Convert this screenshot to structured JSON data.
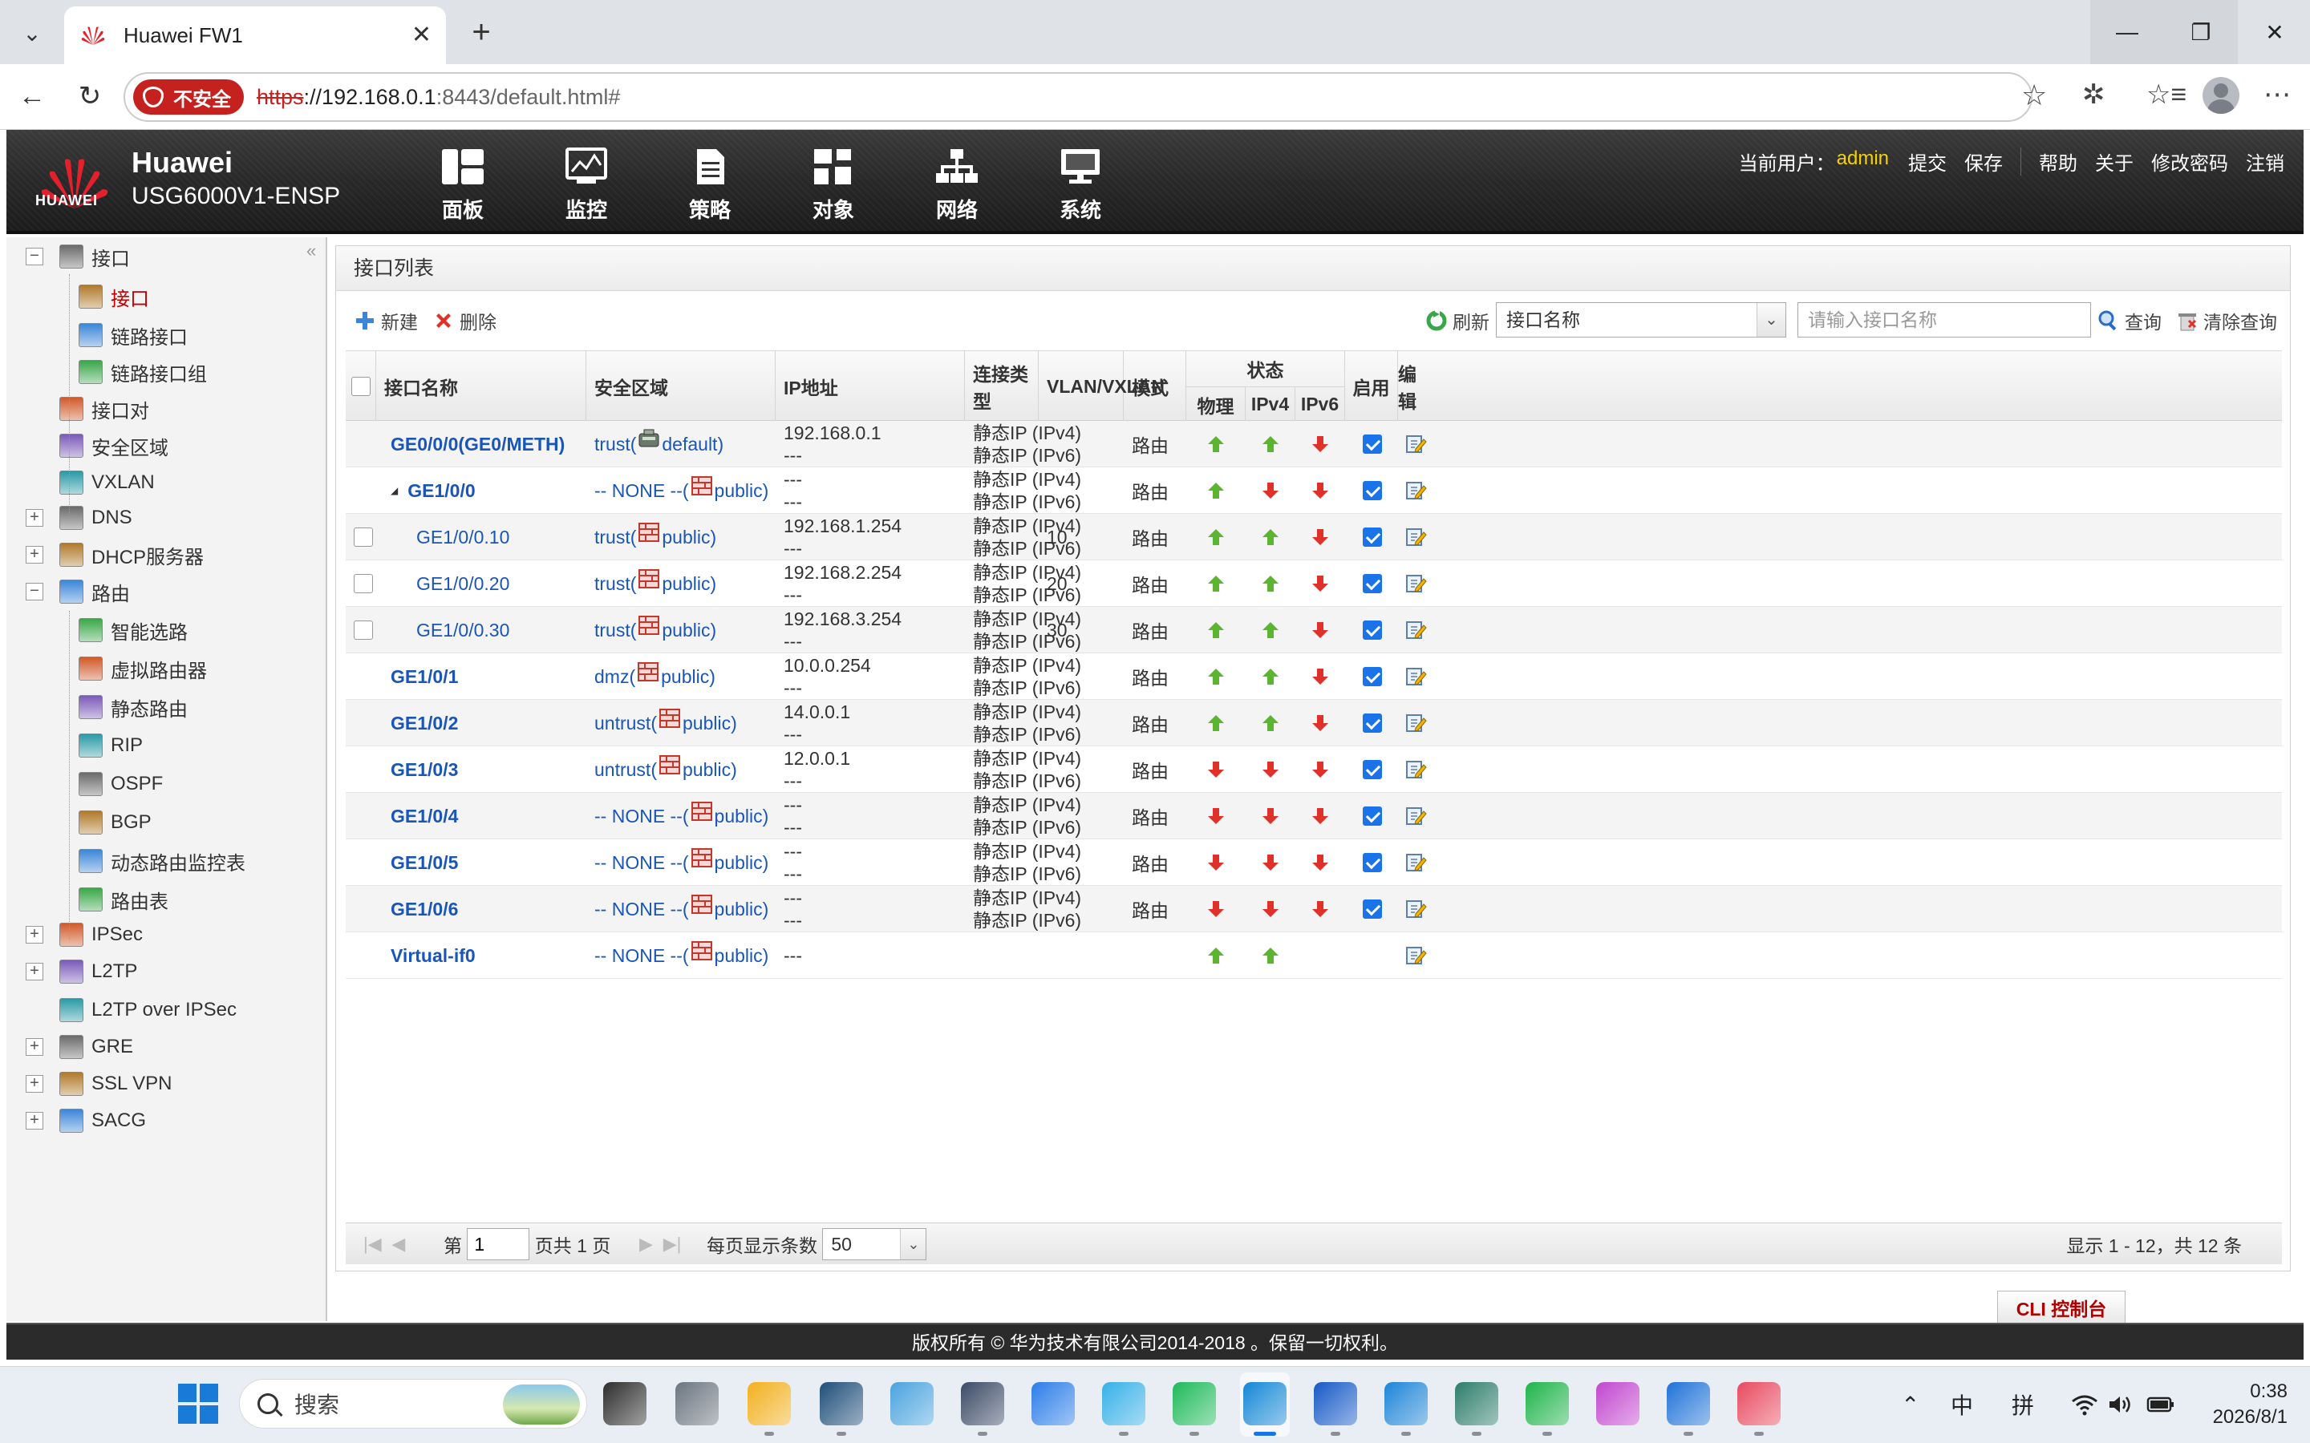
{
  "browser": {
    "tab_title": "Huawei FW1",
    "insecure_label": "不安全",
    "url_scheme": "https",
    "url_host": "://192.168.0.1",
    "url_port_path": ":8443/default.html#"
  },
  "header": {
    "brand_name": "Huawei",
    "model": "USG6000V1-ENSP",
    "logo_text": "HUAWEI",
    "nav": [
      {
        "label": "面板",
        "icon": "dashboard-icon"
      },
      {
        "label": "监控",
        "icon": "monitor-icon"
      },
      {
        "label": "策略",
        "icon": "policy-icon"
      },
      {
        "label": "对象",
        "icon": "object-icon"
      },
      {
        "label": "网络",
        "icon": "network-icon"
      },
      {
        "label": "系统",
        "icon": "system-icon"
      }
    ],
    "current_user_label": "当前用户：",
    "current_user": "admin",
    "links": [
      "提交",
      "保存",
      "帮助",
      "关于",
      "修改密码",
      "注销"
    ]
  },
  "sidebar": {
    "items": [
      {
        "label": "接口",
        "level": 0,
        "toggle": "−",
        "icon": "interface-icon"
      },
      {
        "label": "接口",
        "level": 1,
        "active": true,
        "icon": "interface-icon"
      },
      {
        "label": "链路接口",
        "level": 1,
        "icon": "link-interface-icon"
      },
      {
        "label": "链路接口组",
        "level": 1,
        "icon": "link-group-icon"
      },
      {
        "label": "接口对",
        "level": 0,
        "icon": "interface-pair-icon"
      },
      {
        "label": "安全区域",
        "level": 0,
        "icon": "security-zone-icon"
      },
      {
        "label": "VXLAN",
        "level": 0,
        "icon": "vxlan-icon"
      },
      {
        "label": "DNS",
        "level": 0,
        "toggle": "+",
        "icon": "dns-icon"
      },
      {
        "label": "DHCP服务器",
        "level": 0,
        "toggle": "+",
        "icon": "dhcp-icon"
      },
      {
        "label": "路由",
        "level": 0,
        "toggle": "−",
        "icon": "route-icon"
      },
      {
        "label": "智能选路",
        "level": 1,
        "icon": "smart-route-icon"
      },
      {
        "label": "虚拟路由器",
        "level": 1,
        "icon": "virtual-router-icon"
      },
      {
        "label": "静态路由",
        "level": 1,
        "icon": "static-route-icon"
      },
      {
        "label": "RIP",
        "level": 1,
        "icon": "rip-icon"
      },
      {
        "label": "OSPF",
        "level": 1,
        "icon": "ospf-icon"
      },
      {
        "label": "BGP",
        "level": 1,
        "icon": "bgp-icon"
      },
      {
        "label": "动态路由监控表",
        "level": 1,
        "icon": "route-monitor-icon"
      },
      {
        "label": "路由表",
        "level": 1,
        "icon": "route-table-icon"
      },
      {
        "label": "IPSec",
        "level": 0,
        "toggle": "+",
        "icon": "ipsec-icon"
      },
      {
        "label": "L2TP",
        "level": 0,
        "toggle": "+",
        "icon": "l2tp-icon"
      },
      {
        "label": "L2TP over IPSec",
        "level": 0,
        "icon": "l2tp-ipsec-icon"
      },
      {
        "label": "GRE",
        "level": 0,
        "toggle": "+",
        "icon": "gre-icon"
      },
      {
        "label": "SSL VPN",
        "level": 0,
        "toggle": "+",
        "icon": "ssl-vpn-icon"
      },
      {
        "label": "SACG",
        "level": 0,
        "toggle": "+",
        "icon": "sacg-icon"
      }
    ]
  },
  "panel": {
    "title": "接口列表",
    "new_label": "新建",
    "delete_label": "删除",
    "refresh_label": "刷新",
    "search_field": "接口名称",
    "search_placeholder": "请输入接口名称",
    "query_label": "查询",
    "clear_label": "清除查询"
  },
  "table": {
    "headers": {
      "name": "接口名称",
      "zone": "安全区域",
      "ip": "IP地址",
      "conn_type": "连接类型",
      "vlan": "VLAN/VXLAN",
      "mode": "模式",
      "state": "状态",
      "phys": "物理",
      "ipv4": "IPv4",
      "ipv6": "IPv6",
      "enable": "启用",
      "edit": "编辑"
    },
    "rows": [
      {
        "name": "GE0/0/0(GE0/METH)",
        "bold": true,
        "check": false,
        "indent": 0,
        "zone": "trust(",
        "zone_vr": "default)",
        "zone_icon": "router",
        "ip1": "192.168.0.1",
        "ip2": "---",
        "c1": "静态IP (IPv4)",
        "c2": "静态IP (IPv6)",
        "vlan": "",
        "mode": "路由",
        "phys": "up",
        "v4": "up",
        "v6": "down",
        "enable": true
      },
      {
        "name": "GE1/0/0",
        "bold": true,
        "check": false,
        "indent": 1,
        "expander": "◢",
        "zone": "-- NONE --(",
        "zone_vr": "public)",
        "zone_icon": "firewall",
        "ip1": "---",
        "ip2": "---",
        "c1": "静态IP (IPv4)",
        "c2": "静态IP (IPv6)",
        "vlan": "",
        "mode": "路由",
        "phys": "up",
        "v4": "down",
        "v6": "down",
        "enable": true
      },
      {
        "name": "GE1/0/0.10",
        "bold": false,
        "check": true,
        "indent": 2,
        "zone": "trust(",
        "zone_vr": "public)",
        "zone_icon": "firewall",
        "ip1": "192.168.1.254",
        "ip2": "---",
        "c1": "静态IP (IPv4)",
        "c2": "静态IP (IPv6)",
        "vlan": "10",
        "mode": "路由",
        "phys": "up",
        "v4": "up",
        "v6": "down",
        "enable": true
      },
      {
        "name": "GE1/0/0.20",
        "bold": false,
        "check": true,
        "indent": 2,
        "zone": "trust(",
        "zone_vr": "public)",
        "zone_icon": "firewall",
        "ip1": "192.168.2.254",
        "ip2": "---",
        "c1": "静态IP (IPv4)",
        "c2": "静态IP (IPv6)",
        "vlan": "20",
        "mode": "路由",
        "phys": "up",
        "v4": "up",
        "v6": "down",
        "enable": true
      },
      {
        "name": "GE1/0/0.30",
        "bold": false,
        "check": true,
        "indent": 2,
        "zone": "trust(",
        "zone_vr": "public)",
        "zone_icon": "firewall",
        "ip1": "192.168.3.254",
        "ip2": "---",
        "c1": "静态IP (IPv4)",
        "c2": "静态IP (IPv6)",
        "vlan": "30",
        "mode": "路由",
        "phys": "up",
        "v4": "up",
        "v6": "down",
        "enable": true
      },
      {
        "name": "GE1/0/1",
        "bold": true,
        "check": false,
        "indent": 0,
        "zone": "dmz(",
        "zone_vr": "public)",
        "zone_icon": "firewall",
        "ip1": "10.0.0.254",
        "ip2": "---",
        "c1": "静态IP (IPv4)",
        "c2": "静态IP (IPv6)",
        "vlan": "",
        "mode": "路由",
        "phys": "up",
        "v4": "up",
        "v6": "down",
        "enable": true
      },
      {
        "name": "GE1/0/2",
        "bold": true,
        "check": false,
        "indent": 0,
        "zone": "untrust(",
        "zone_vr": "public)",
        "zone_icon": "firewall",
        "ip1": "14.0.0.1",
        "ip2": "---",
        "c1": "静态IP (IPv4)",
        "c2": "静态IP (IPv6)",
        "vlan": "",
        "mode": "路由",
        "phys": "up",
        "v4": "up",
        "v6": "down",
        "enable": true
      },
      {
        "name": "GE1/0/3",
        "bold": true,
        "check": false,
        "indent": 0,
        "zone": "untrust(",
        "zone_vr": "public)",
        "zone_icon": "firewall",
        "ip1": "12.0.0.1",
        "ip2": "---",
        "c1": "静态IP (IPv4)",
        "c2": "静态IP (IPv6)",
        "vlan": "",
        "mode": "路由",
        "phys": "down",
        "v4": "down",
        "v6": "down",
        "enable": true
      },
      {
        "name": "GE1/0/4",
        "bold": true,
        "check": false,
        "indent": 0,
        "zone": "-- NONE --(",
        "zone_vr": "public)",
        "zone_icon": "firewall",
        "ip1": "---",
        "ip2": "---",
        "c1": "静态IP (IPv4)",
        "c2": "静态IP (IPv6)",
        "vlan": "",
        "mode": "路由",
        "phys": "down",
        "v4": "down",
        "v6": "down",
        "enable": true
      },
      {
        "name": "GE1/0/5",
        "bold": true,
        "check": false,
        "indent": 0,
        "zone": "-- NONE --(",
        "zone_vr": "public)",
        "zone_icon": "firewall",
        "ip1": "---",
        "ip2": "---",
        "c1": "静态IP (IPv4)",
        "c2": "静态IP (IPv6)",
        "vlan": "",
        "mode": "路由",
        "phys": "down",
        "v4": "down",
        "v6": "down",
        "enable": true
      },
      {
        "name": "GE1/0/6",
        "bold": true,
        "check": false,
        "indent": 0,
        "zone": "-- NONE --(",
        "zone_vr": "public)",
        "zone_icon": "firewall",
        "ip1": "---",
        "ip2": "---",
        "c1": "静态IP (IPv4)",
        "c2": "静态IP (IPv6)",
        "vlan": "",
        "mode": "路由",
        "phys": "down",
        "v4": "down",
        "v6": "down",
        "enable": true
      },
      {
        "name": "Virtual-if0",
        "bold": true,
        "check": false,
        "indent": 0,
        "zone": "-- NONE --(",
        "zone_vr": "public)",
        "zone_icon": "firewall",
        "ip1": "---",
        "ip2": "",
        "c1": "",
        "c2": "",
        "vlan": "",
        "mode": "",
        "phys": "up",
        "v4": "up",
        "v6": "",
        "enable": null
      }
    ]
  },
  "pager": {
    "page_prefix": "第",
    "page": "1",
    "page_suffix": "页共 1 页",
    "per_page_label": "每页显示条数",
    "per_page": "50",
    "summary": "显示 1 - 12，共 12 条"
  },
  "cli_label": "CLI 控制台",
  "footer": "版权所有 © 华为技术有限公司2014-2018 。保留一切权利。",
  "taskbar": {
    "search_placeholder": "搜索",
    "ime1": "中",
    "ime2": "拼",
    "time": "0:38",
    "date": "2026/8/1"
  },
  "colors": {
    "link": "#1a55b8",
    "active_nav": "#c00000",
    "up_arrow": "#5cb531",
    "down_arrow": "#e0302a",
    "admin": "#f5d200"
  }
}
